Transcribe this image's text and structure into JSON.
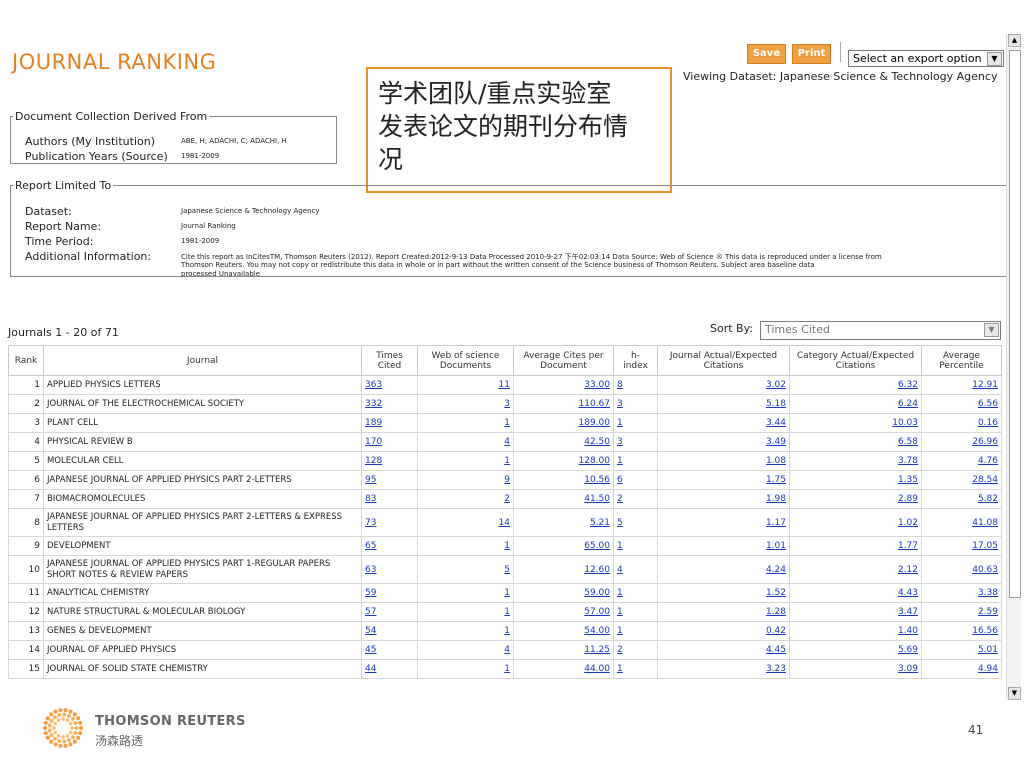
{
  "header": {
    "title": "JOURNAL RANKING",
    "save_label": "Save",
    "print_label": "Print",
    "export_placeholder": "Select an export option",
    "viewing_dataset": "Viewing Dataset: Japanese Science & Technology Agency"
  },
  "callout": {
    "line1": "学术团队/重点实验室",
    "line2": "发表论文的期刊分布情",
    "line3": "况"
  },
  "doc_collection": {
    "legend": "Document Collection Derived From",
    "authors_label": "Authors (My Institution)",
    "authors_value": "ABE, H; ADACHI, C; ADACHI, H",
    "years_label": "Publication Years (Source)",
    "years_value": "1981-2009"
  },
  "report_limited": {
    "legend": "Report Limited To",
    "dataset_label": "Dataset:",
    "dataset_value": "Japanese Science & Technology Agency",
    "report_name_label": "Report Name:",
    "report_name_value": "Journal Ranking",
    "time_period_label": "Time Period:",
    "time_period_value": "1981-2009",
    "additional_label": "Additional Information:",
    "additional_line1": "Cite this report as InCitesTM, Thomson Reuters (2012). Report Created:2012-9-13  Data Processed 2010-9-27 下午02:03:14  Data Source: Web of Science ® This data is reproduced under a license from",
    "additional_line2": "Thomson Reuters. You may not copy or redistribute this data in whole or in part without the written consent of the Science business of Thomson Reuters. Subject area baseline data",
    "additional_line3": "processed Unavailable"
  },
  "list": {
    "count_text": "Journals  1 - 20  of  71",
    "sort_label": "Sort By:",
    "sort_value": "Times Cited"
  },
  "table": {
    "headers": {
      "rank": "Rank",
      "journal": "Journal",
      "times_cited_1": "Times",
      "times_cited_2": "Cited",
      "wos_1": "Web of science",
      "wos_2": "Documents",
      "avg_1": "Average Cites per",
      "avg_2": "Document",
      "h_1": "h-",
      "h_2": "index",
      "jae_1": "Journal Actual/Expected",
      "jae_2": "Citations",
      "cae_1": "Category Actual/Expected",
      "cae_2": "Citations",
      "pct_1": "Average",
      "pct_2": "Percentile"
    },
    "rows": [
      {
        "rank": "1",
        "journal": "APPLIED PHYSICS LETTERS",
        "times_cited": "363",
        "docs": "11",
        "avg": "33.00",
        "h": "8",
        "jae": "3.02",
        "cae": "6.32",
        "pct": "12.91"
      },
      {
        "rank": "2",
        "journal": "JOURNAL OF THE ELECTROCHEMICAL SOCIETY",
        "times_cited": "332",
        "docs": "3",
        "avg": "110.67",
        "h": "3",
        "jae": "5.18",
        "cae": "6.24",
        "pct": "6.56"
      },
      {
        "rank": "3",
        "journal": "PLANT CELL",
        "times_cited": "189",
        "docs": "1",
        "avg": "189.00",
        "h": "1",
        "jae": "3.44",
        "cae": "10.03",
        "pct": "0.16"
      },
      {
        "rank": "4",
        "journal": "PHYSICAL REVIEW B",
        "times_cited": "170",
        "docs": "4",
        "avg": "42.50",
        "h": "3",
        "jae": "3.49",
        "cae": "6.58",
        "pct": "26.96"
      },
      {
        "rank": "5",
        "journal": "MOLECULAR CELL",
        "times_cited": "128",
        "docs": "1",
        "avg": "128.00",
        "h": "1",
        "jae": "1.08",
        "cae": "3.78",
        "pct": "4.76"
      },
      {
        "rank": "6",
        "journal": "JAPANESE JOURNAL OF APPLIED PHYSICS PART 2-LETTERS",
        "times_cited": "95",
        "docs": "9",
        "avg": "10.56",
        "h": "6",
        "jae": "1.75",
        "cae": "1.35",
        "pct": "28.54"
      },
      {
        "rank": "7",
        "journal": "BIOMACROMOLECULES",
        "times_cited": "83",
        "docs": "2",
        "avg": "41.50",
        "h": "2",
        "jae": "1.98",
        "cae": "2.89",
        "pct": "5.82"
      },
      {
        "rank": "8",
        "journal": "JAPANESE JOURNAL OF APPLIED PHYSICS PART 2-LETTERS & EXPRESS LETTERS",
        "times_cited": "73",
        "docs": "14",
        "avg": "5.21",
        "h": "5",
        "jae": "1.17",
        "cae": "1.02",
        "pct": "41.08"
      },
      {
        "rank": "9",
        "journal": "DEVELOPMENT",
        "times_cited": "65",
        "docs": "1",
        "avg": "65.00",
        "h": "1",
        "jae": "1.01",
        "cae": "1.77",
        "pct": "17.05"
      },
      {
        "rank": "10",
        "journal": "JAPANESE JOURNAL OF APPLIED PHYSICS PART 1-REGULAR PAPERS SHORT NOTES & REVIEW PAPERS",
        "times_cited": "63",
        "docs": "5",
        "avg": "12.60",
        "h": "4",
        "jae": "4.24",
        "cae": "2.12",
        "pct": "40.63"
      },
      {
        "rank": "11",
        "journal": "ANALYTICAL CHEMISTRY",
        "times_cited": "59",
        "docs": "1",
        "avg": "59.00",
        "h": "1",
        "jae": "1.52",
        "cae": "4.43",
        "pct": "3.38"
      },
      {
        "rank": "12",
        "journal": "NATURE STRUCTURAL & MOLECULAR BIOLOGY",
        "times_cited": "57",
        "docs": "1",
        "avg": "57.00",
        "h": "1",
        "jae": "1.28",
        "cae": "3.47",
        "pct": "2.59"
      },
      {
        "rank": "13",
        "journal": "GENES & DEVELOPMENT",
        "times_cited": "54",
        "docs": "1",
        "avg": "54.00",
        "h": "1",
        "jae": "0.42",
        "cae": "1.40",
        "pct": "16.56"
      },
      {
        "rank": "14",
        "journal": "JOURNAL OF APPLIED PHYSICS",
        "times_cited": "45",
        "docs": "4",
        "avg": "11.25",
        "h": "2",
        "jae": "4.45",
        "cae": "5.69",
        "pct": "5.01"
      },
      {
        "rank": "15",
        "journal": "JOURNAL OF SOLID STATE CHEMISTRY",
        "times_cited": "44",
        "docs": "1",
        "avg": "44.00",
        "h": "1",
        "jae": "3.23",
        "cae": "3.09",
        "pct": "4.94"
      }
    ]
  },
  "footer": {
    "brand_en": "THOMSON REUTERS",
    "brand_cn": "汤森路透",
    "page_number": "41",
    "logo_icon": "thomson-reuters-logo-icon"
  },
  "colors": {
    "accent": "#e8801e",
    "link": "#1a39b8",
    "button": "#f0a040"
  }
}
